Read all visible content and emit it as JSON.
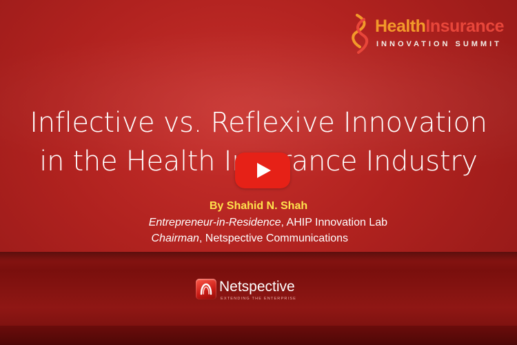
{
  "logo": {
    "word1": "Health",
    "word2": "Insurance",
    "subtitle": "INNOVATION SUMMIT",
    "icon": "helix-logo-icon"
  },
  "title": {
    "line1": "Inflective vs. Reflexive Innovation",
    "line2": "in the Health Insurance Industry"
  },
  "player": {
    "play_icon": "play-icon",
    "color": "#e62117"
  },
  "byline": "By Shahid N. Shah",
  "roles": [
    {
      "role": "Entrepreneur-in-Residence",
      "org": ", AHIP Innovation Lab"
    },
    {
      "role": "Chairman",
      "org": ", Netspective Communications"
    }
  ],
  "company": {
    "name": "Netspective",
    "tagline": "EXTENDING THE ENTERPRISE",
    "icon": "netspective-logo-icon"
  },
  "colors": {
    "background": "#b0221f",
    "byline": "#ffe34d",
    "logo_orange": "#f39a2a",
    "logo_red": "#e8463a"
  }
}
